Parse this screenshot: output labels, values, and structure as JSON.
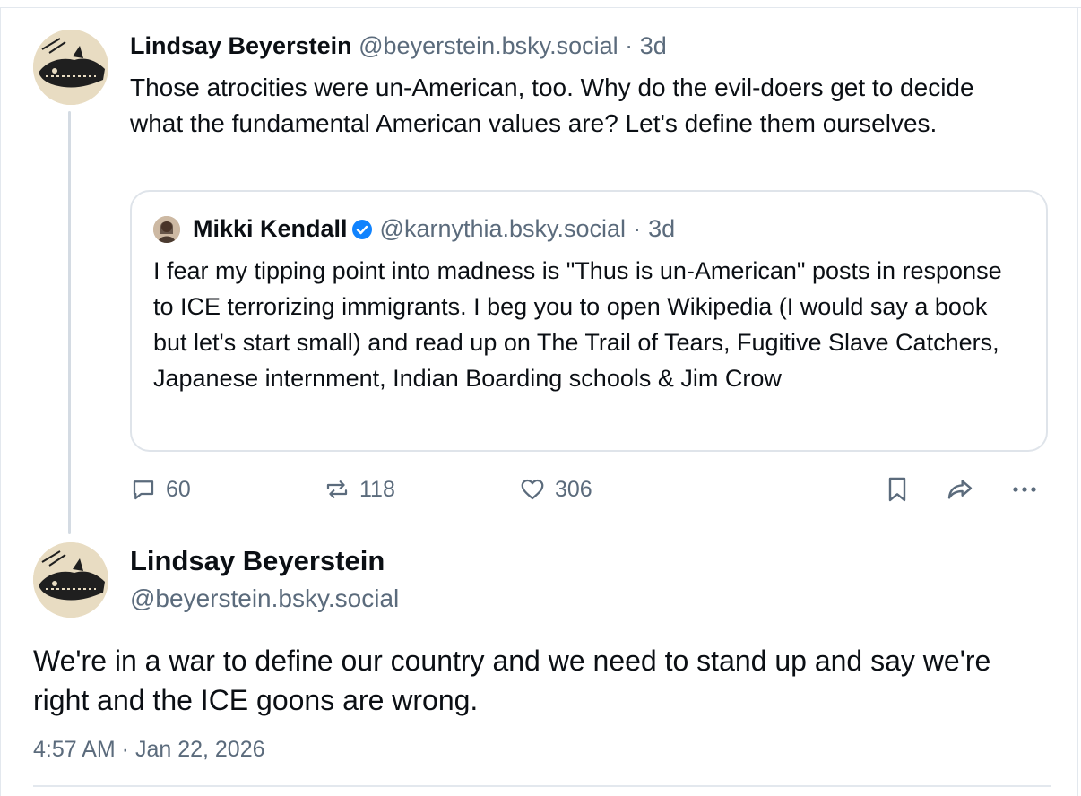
{
  "parent_post": {
    "author_name": "Lindsay Beyerstein",
    "author_handle": "@beyerstein.bsky.social",
    "separator": "·",
    "time_ago": "3d",
    "text": "Those atrocities were un-American, too. Why do the evil-doers get to decide what the fundamental American values are? Let's define them ourselves.",
    "quote": {
      "author_name": "Mikki Kendall",
      "verified": true,
      "author_handle": "@karnythia.bsky.social",
      "separator": "·",
      "time_ago": "3d",
      "text": "I fear my tipping point into madness is \"Thus is un-American\" posts in response to ICE terrorizing immigrants. I beg you to open Wikipedia (I would say a book but let's start small) and read up on The Trail of Tears, Fugitive Slave Catchers, Japanese internment, Indian Boarding schools & Jim Crow"
    },
    "actions": {
      "replies": "60",
      "reposts": "118",
      "likes": "306",
      "icons": [
        "reply-icon",
        "repost-icon",
        "like-icon",
        "bookmark-icon",
        "share-icon",
        "more-icon"
      ]
    }
  },
  "main_post": {
    "author_name": "Lindsay Beyerstein",
    "author_handle": "@beyerstein.bsky.social",
    "text": "We're in a war to define our country and we need to stand up and say we're right and the ICE goons are wrong.",
    "timestamp": "4:57 AM · Jan 22, 2026"
  },
  "colors": {
    "text": "#0b0f14",
    "muted": "#5b6b7c",
    "border": "#dfe4ea",
    "verified": "#1083fe"
  }
}
